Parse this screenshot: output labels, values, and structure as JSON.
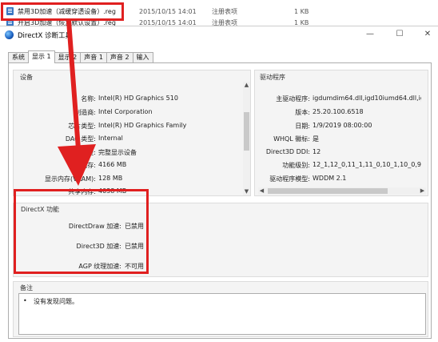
{
  "explorer": {
    "rows": [
      {
        "name": "禁用3D加速（减缓穿透设备）.reg",
        "date": "2015/10/15 14:01",
        "type": "注册表项",
        "size": "1 KB"
      },
      {
        "name": "开启3D加速（恢复默认设置）.reg",
        "date": "2015/10/15 14:01",
        "type": "注册表项",
        "size": "1 KB"
      }
    ]
  },
  "window": {
    "title": "DirectX 诊断工具",
    "controls": {
      "minimize": "—",
      "maximize": "☐",
      "close": "✕"
    }
  },
  "tabs": [
    "系统",
    "显示 1",
    "显示 2",
    "声音 1",
    "声音 2",
    "输入"
  ],
  "device": {
    "label": "设备",
    "fields": [
      {
        "key": "名称:",
        "value": "Intel(R) HD Graphics 510"
      },
      {
        "key": "制造商:",
        "value": "Intel Corporation"
      },
      {
        "key": "芯片类型:",
        "value": "Intel(R) HD Graphics Family"
      },
      {
        "key": "DAC 类型:",
        "value": "Internal"
      },
      {
        "key": "设备类型:",
        "value": "完整显示设备"
      },
      {
        "key": "总内存:",
        "value": "4166 MB"
      },
      {
        "key": "显示内存(VRAM):",
        "value": "128 MB"
      },
      {
        "key": "共享内存:",
        "value": "4038 MB"
      }
    ]
  },
  "drivers": {
    "label": "驱动程序",
    "fields": [
      {
        "key": "主驱动程序:",
        "value": "igdumdim64.dll,igd10iumd64.dll,igd1"
      },
      {
        "key": "版本:",
        "value": "25.20.100.6518"
      },
      {
        "key": "日期:",
        "value": "1/9/2019 08:00:00"
      },
      {
        "key": "WHQL 徽标:",
        "value": "是"
      },
      {
        "key": "Direct3D DDI:",
        "value": "12"
      },
      {
        "key": "功能级别:",
        "value": "12_1,12_0,11_1,11_0,10_1,10_0,9_3,9_2"
      },
      {
        "key": "驱动程序模型:",
        "value": "WDDM 2.1"
      }
    ]
  },
  "directx_features": {
    "label": "DirectX 功能",
    "fields": [
      {
        "key": "DirectDraw 加速:",
        "value": "已禁用"
      },
      {
        "key": "Direct3D 加速:",
        "value": "已禁用"
      },
      {
        "key": "AGP 纹理加速:",
        "value": "不可用"
      }
    ]
  },
  "notes": {
    "label": "备注",
    "items": [
      "没有发现问题。"
    ]
  },
  "colors": {
    "annotation": "#e02020",
    "accent": "#1b5fbf"
  }
}
